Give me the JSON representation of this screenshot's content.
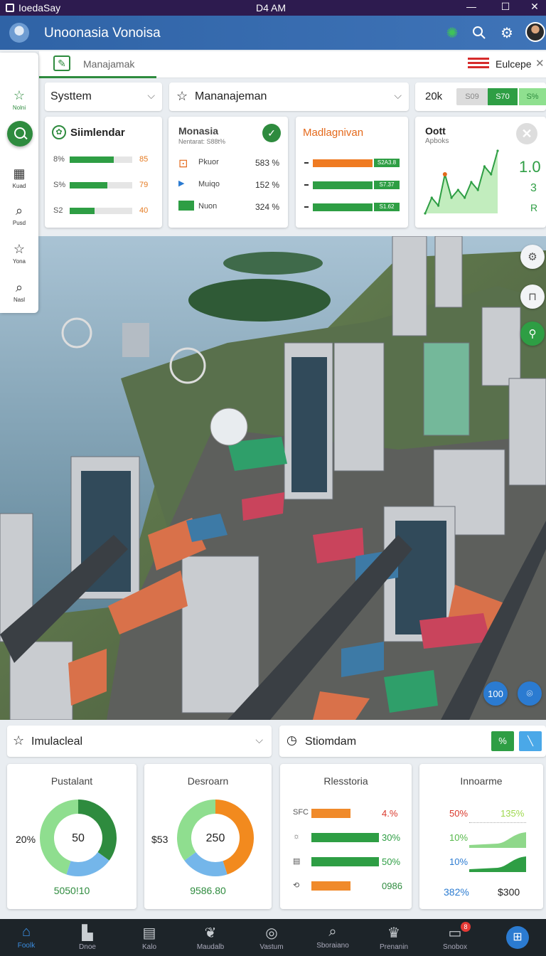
{
  "window": {
    "app_name": "IoedaSay",
    "clock": "D4 AM",
    "minimize": "—",
    "maximize": "☐",
    "close": "✕"
  },
  "header": {
    "title": "Unoonasia Vonoisa"
  },
  "subbar": {
    "tab_label": "Manajamak",
    "region_label": "Eulcepe"
  },
  "sidebar": {
    "items": [
      {
        "label": "Nolni",
        "icon": "star-outline-icon"
      },
      {
        "label": "",
        "icon": "search-icon"
      },
      {
        "label": "Kuad",
        "icon": "grid-icon"
      },
      {
        "label": "Pusd",
        "icon": "search-icon"
      },
      {
        "label": "Yona",
        "icon": "star-outline-icon"
      },
      {
        "label": "Nasl",
        "icon": "search-icon"
      }
    ]
  },
  "filters": {
    "system": "Systtem",
    "management": "Mananajeman",
    "stat_label": "20k",
    "segments": [
      "S09",
      "S70",
      "S%"
    ]
  },
  "cards": {
    "simulendar": {
      "title": "Siimlendar",
      "rows": [
        {
          "label": "8%",
          "value": "85",
          "fill": 0.7
        },
        {
          "label": "S%",
          "value": "79",
          "fill": 0.6
        },
        {
          "label": "S2",
          "value": "40",
          "fill": 0.4
        }
      ]
    },
    "monasia": {
      "title": "Monasia",
      "subtitle": "Nentarat: S88t%",
      "rows": [
        {
          "label": "Pkuor",
          "value": "583 %",
          "icon": "document-icon"
        },
        {
          "label": "Muiqo",
          "value": "152 %",
          "icon": "pin-icon"
        },
        {
          "label": "Nuon",
          "value": "324 %",
          "icon": "green-square-icon"
        }
      ]
    },
    "madlagnivan": {
      "title": "Madlagnivan",
      "rows": [
        {
          "value": "S2A3.8",
          "color": "#ef7b22"
        },
        {
          "value": "S7.37",
          "color": "#2e9e44"
        },
        {
          "value": "S1.62",
          "color": "#2e9e44"
        }
      ]
    },
    "oott": {
      "title": "Oott",
      "subtitle": "Apboks",
      "big_value": "1.0",
      "values": [
        "3",
        "R"
      ],
      "chart_data": {
        "type": "line",
        "x": [
          1,
          2,
          3,
          4,
          5,
          6,
          7,
          8,
          9,
          10,
          11,
          12
        ],
        "values": [
          1,
          3,
          2,
          6,
          3,
          4,
          3,
          5,
          4,
          7,
          6,
          9
        ]
      }
    }
  },
  "map_controls": {
    "zoom_level": "100"
  },
  "bottom_filters": {
    "left": "Imulacleal",
    "right": "Stiomdam",
    "toggle_left": "%",
    "toggle_right": "╲"
  },
  "bottom_cards": {
    "pustalant": {
      "title": "Pustalant",
      "center_value": "50",
      "side_label": "20%",
      "footer": "5050!10",
      "chart_data": {
        "type": "pie",
        "values": [
          35,
          20,
          45
        ],
        "colors": [
          "#2e8b3e",
          "#74b6ea",
          "#8fde8f"
        ]
      }
    },
    "desroarn": {
      "title": "Desroarn",
      "center_value": "250",
      "side_label": "$53",
      "footer": "9586.80",
      "chart_data": {
        "type": "pie",
        "values": [
          45,
          20,
          35
        ],
        "colors": [
          "#f28a1e",
          "#74b6ea",
          "#8fde8f"
        ]
      }
    },
    "rlesstoria": {
      "title": "Rlesstoria",
      "rows": [
        {
          "label": "SFC",
          "value": "4.%",
          "fill": 0.55,
          "color": "#f08a2a",
          "value_color": "#d9382b"
        },
        {
          "label": "☼",
          "value": "30%",
          "fill": 0.95,
          "color": "#2e9e44",
          "value_color": "#2e9e44"
        },
        {
          "label": "▤",
          "value": "50%",
          "fill": 0.95,
          "color": "#2e9e44",
          "value_color": "#2e9e44"
        },
        {
          "label": "⟲",
          "value": "0986",
          "fill": 0.55,
          "color": "#f08a2a",
          "value_color": "#2e8b3e"
        }
      ]
    },
    "innoarme": {
      "title": "Innoarme",
      "rows": [
        {
          "left": "50%",
          "right": "135%",
          "left_color": "#d9382b",
          "right_color": "#9ed84d"
        },
        {
          "left": "10%",
          "right": "",
          "left_color": "#56b84a",
          "right_color": "#56b84a"
        },
        {
          "left": "10%",
          "right": "",
          "left_color": "#2b7bd1",
          "right_color": "#2b7bd1"
        }
      ],
      "footer_left": "382%",
      "footer_right": "$300"
    }
  },
  "nav": [
    {
      "label": "Foolk",
      "icon": "home-icon",
      "active": true
    },
    {
      "label": "Dnoe",
      "icon": "building-icon"
    },
    {
      "label": "Kalo",
      "icon": "chart-icon"
    },
    {
      "label": "Maudalb",
      "icon": "bird-icon"
    },
    {
      "label": "Vastum",
      "icon": "target-icon"
    },
    {
      "label": "Sboraiano",
      "icon": "search-icon"
    },
    {
      "label": "Prenanin",
      "icon": "crown-icon"
    },
    {
      "label": "Snobox",
      "icon": "inbox-icon",
      "badge": "8"
    },
    {
      "label": "",
      "icon": "store-icon"
    }
  ],
  "colors": {
    "accent": "#2e8b3e",
    "appbar": "#3469ac",
    "titlebar": "#2d1b4f"
  }
}
